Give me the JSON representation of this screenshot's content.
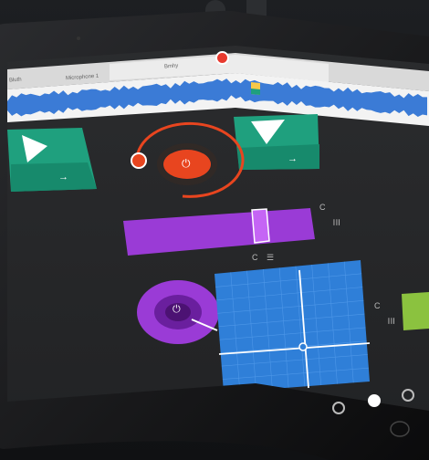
{
  "scene": {
    "description_colors": {
      "background": "#161719",
      "device": "#0a0a0b",
      "screen": "#262729",
      "waveform": "#3a7ad6",
      "green": "#1fa07e",
      "orange": "#e8451f",
      "purple": "#9a3bd6",
      "blue_pad": "#2f7fd8"
    }
  },
  "app": {
    "tabs": [
      {
        "label": "Bluth"
      },
      {
        "label": "Microphone 1"
      },
      {
        "label": ""
      },
      {
        "label": "Bmhy"
      }
    ],
    "record_icon": "record-icon",
    "menu_icon": "more-icon"
  },
  "controls": {
    "play_left_icon": "play-icon",
    "arrow_left": "→",
    "arrow_right": "→",
    "play_right_icon": "play-down-icon",
    "orange_power": "⏻",
    "purple_power": "⏻",
    "fader_reset": "C",
    "fader_menu": "☰",
    "pad_reset": "C",
    "pad_menu": "☰",
    "page_dots": 3,
    "active_page": 2
  }
}
